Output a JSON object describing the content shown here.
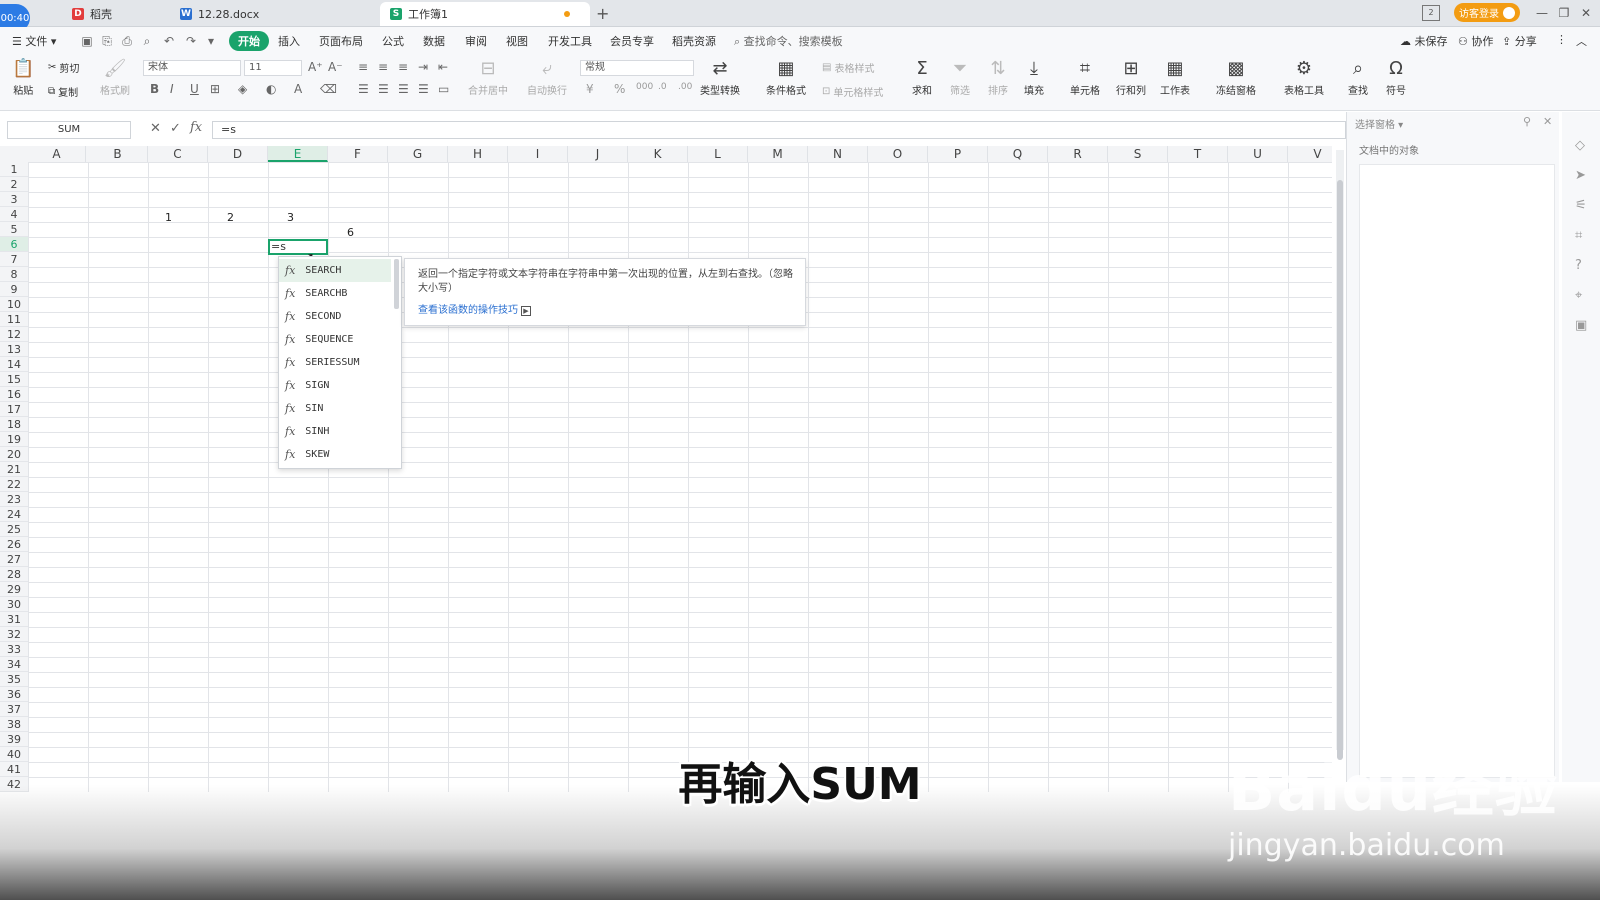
{
  "timer": "00:40",
  "tabs": [
    {
      "label": "稻壳",
      "icon": "wps-logo-icon"
    },
    {
      "label": "12.28.docx",
      "icon": "word-doc-icon"
    },
    {
      "label": "工作簿1",
      "icon": "sheet-icon"
    }
  ],
  "login_label": "访客登录",
  "menu": {
    "file": "文件",
    "items": [
      "开始",
      "插入",
      "页面布局",
      "公式",
      "数据",
      "审阅",
      "视图",
      "开发工具",
      "会员专享",
      "稻壳资源"
    ],
    "search": "查找命令、搜索模板",
    "unsaved": "未保存",
    "collab": "协作",
    "share": "分享"
  },
  "ribbon": {
    "paste": "粘贴",
    "cut": "剪切",
    "copy": "复制",
    "format_painter": "格式刷",
    "font_name": "宋体",
    "font_size": "11",
    "merge_center": "合并居中",
    "wrap_text": "自动换行",
    "number_format": "常规",
    "type_convert": "类型转换",
    "cond_format": "条件格式",
    "table_style": "表格样式",
    "cell_style": "单元格样式",
    "sum": "求和",
    "filter": "筛选",
    "sort": "排序",
    "fill": "填充",
    "cell": "单元格",
    "row_col": "行和列",
    "worksheet": "工作表",
    "freeze": "冻结窗格",
    "table_tools": "表格工具",
    "find": "查找",
    "symbol": "符号"
  },
  "formula_bar": {
    "name_box": "SUM",
    "fx": "fx",
    "content": "=s"
  },
  "columns": [
    "A",
    "B",
    "C",
    "D",
    "E",
    "F",
    "G",
    "H",
    "I",
    "J",
    "K",
    "L",
    "M",
    "N",
    "O",
    "P",
    "Q",
    "R",
    "S",
    "T",
    "U",
    "V"
  ],
  "selected_column": "E",
  "rows": [
    "1",
    "2",
    "3",
    "4",
    "5",
    "6",
    "7",
    "8",
    "9",
    "10",
    "11",
    "12",
    "13",
    "14",
    "15",
    "16",
    "17",
    "18",
    "19",
    "20",
    "21",
    "22",
    "23",
    "24",
    "25",
    "26",
    "27",
    "28",
    "29",
    "30",
    "31",
    "32",
    "33",
    "34",
    "35",
    "36",
    "37",
    "38",
    "39",
    "40",
    "41",
    "42"
  ],
  "selected_row": "6",
  "cells": {
    "B4": "1",
    "C4": "2",
    "D4": "3",
    "E5": "6",
    "E6": "=s"
  },
  "autocomplete": [
    "SEARCH",
    "SEARCHB",
    "SECOND",
    "SEQUENCE",
    "SERIESSUM",
    "SIGN",
    "SIN",
    "SINH",
    "SKEW"
  ],
  "tooltip": {
    "text": "返回一个指定字符或文本字符串在字符串中第一次出现的位置，从左到右查找。（忽略大小写）",
    "link": "查看该函数的操作技巧"
  },
  "right_pane": {
    "title": "选择窗格",
    "subtitle": "文档中的对象"
  },
  "caption": "再输入SUM",
  "watermark": {
    "logo": "Baidu经验",
    "url": "jingyan.baidu.com"
  }
}
